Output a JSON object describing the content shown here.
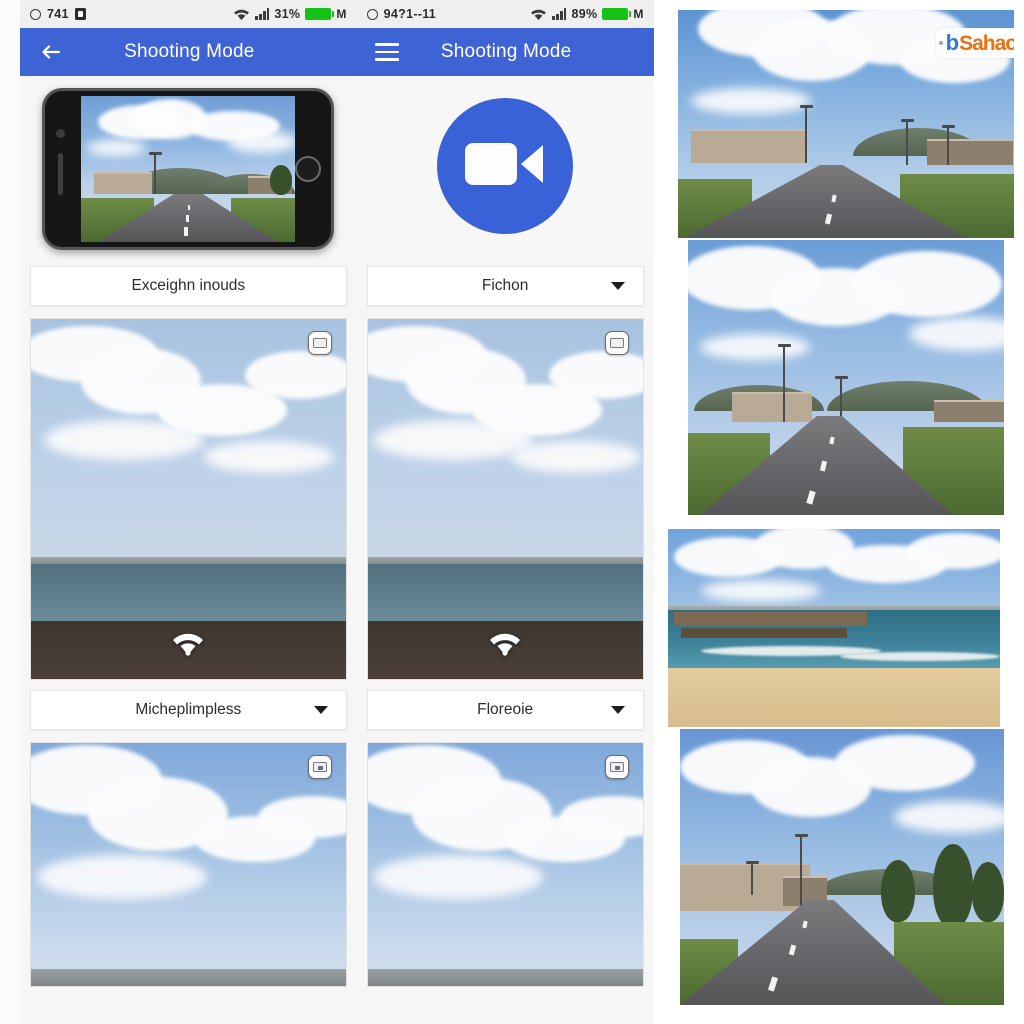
{
  "meta": {
    "app_title": "Shooting Mode"
  },
  "panel_a": {
    "status_bar": {
      "time": "741",
      "signal_percent": "31%",
      "carrier_letter": "M",
      "location_icon": "location-icon",
      "alarm_icon": "alarm-icon",
      "wifi_icon": "wifi-icon",
      "signal_icon": "signal-bars-icon",
      "battery_icon": "battery-icon"
    },
    "app_bar": {
      "title": "Shooting Mode",
      "nav_icon": "back-arrow-icon"
    },
    "hero": {
      "type": "phone-mockup",
      "caption_alt": "landscape road scene on phone screen"
    },
    "labels": [
      {
        "text": "Exceighn inouds",
        "has_chevron": false
      },
      {
        "text": "Micheplimpless",
        "has_chevron": true
      }
    ],
    "cards": [
      {
        "scene": "sea-bay",
        "badge_icon": "photo-badge-icon",
        "overlay_icon": "wifi-icon"
      },
      {
        "scene": "clouds-city",
        "badge_icon": "photo-badge-icon",
        "overlay_icon": "none"
      }
    ]
  },
  "panel_b": {
    "status_bar": {
      "time": "94?1--11",
      "signal_percent": "89%",
      "carrier_letter": "M",
      "location_icon": "location-icon",
      "wifi_icon": "wifi-icon",
      "signal_icon": "signal-bars-icon",
      "battery_icon": "battery-icon"
    },
    "app_bar": {
      "title": "Shooting Mode",
      "nav_icon": "hamburger-menu-icon"
    },
    "hero": {
      "type": "video-camera-circle",
      "icon": "video-camera-icon",
      "circle_color": "#3a62d8"
    },
    "labels": [
      {
        "text": "Fichon",
        "has_chevron": true
      },
      {
        "text": "Floreoie",
        "has_chevron": true
      }
    ],
    "cards": [
      {
        "scene": "sea-bay",
        "badge_icon": "photo-badge-icon",
        "overlay_icon": "wifi-icon"
      },
      {
        "scene": "clouds-city",
        "badge_icon": "photo-badge-icon",
        "overlay_icon": "none"
      }
    ]
  },
  "right_column": {
    "watermark": {
      "dot": "•",
      "b": "b",
      "rest": "Sahac",
      "alt": "bSahack watermark badge"
    },
    "photos": [
      {
        "scene": "road-town",
        "alt": "Two-lane road with buildings and power lines under cumulus clouds"
      },
      {
        "scene": "road-hills",
        "alt": "Highway curving toward hills with street lamp and fence"
      },
      {
        "scene": "beach-pier",
        "alt": "Sandy beach with wooden pier extending into the sea"
      },
      {
        "scene": "road-trees",
        "alt": "Road beside apartment blocks and pine trees with mountains behind"
      }
    ]
  },
  "colors": {
    "app_bar_blue": "#3e63d4",
    "accent_blue": "#3a62d8",
    "status_bar_bg": "#efefef",
    "battery_green": "#17c217",
    "page_bg": "#fbfbfb",
    "card_border": "#e2e2e2",
    "watermark_blue": "#2f7ad8",
    "watermark_orange": "#e8720c"
  }
}
